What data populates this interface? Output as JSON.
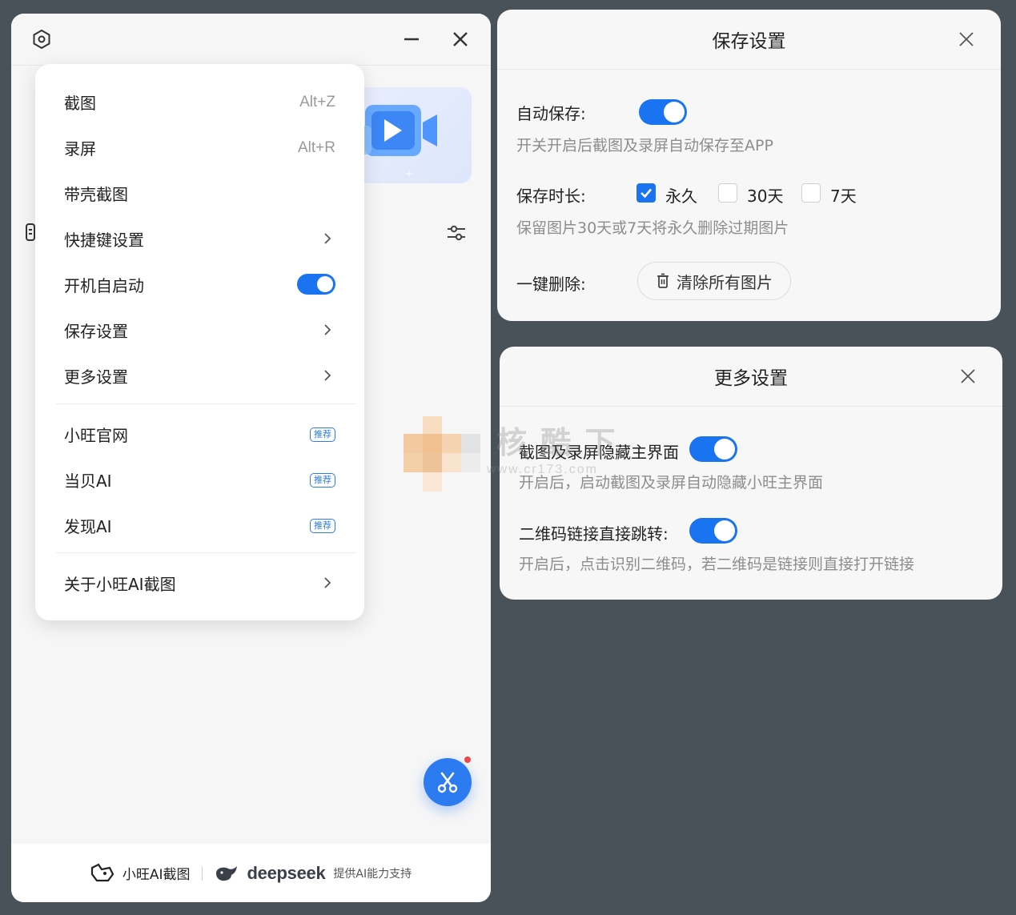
{
  "main_window": {
    "menu": {
      "items": [
        {
          "label": "截图",
          "shortcut": "Alt+Z"
        },
        {
          "label": "录屏",
          "shortcut": "Alt+R"
        },
        {
          "label": "带壳截图"
        },
        {
          "label": "快捷键设置"
        },
        {
          "label": "开机自启动",
          "toggle_on": true
        },
        {
          "label": "保存设置"
        },
        {
          "label": "更多设置"
        },
        {
          "label": "小旺官网",
          "badge": "推荐"
        },
        {
          "label": "当贝AI",
          "badge": "推荐"
        },
        {
          "label": "发现AI",
          "badge": "推荐"
        },
        {
          "label": "关于小旺AI截图"
        }
      ]
    },
    "footer": {
      "app_name": "小旺AI截图",
      "partner": "deepseek",
      "support_text": "提供AI能力支持"
    },
    "fab_icon": "scissors-icon",
    "accent_color": "#2d7bf0"
  },
  "save_settings": {
    "title": "保存设置",
    "auto_save_label": "自动保存:",
    "auto_save_on": true,
    "auto_save_desc": "开关开启后截图及录屏自动保存至APP",
    "duration_label": "保存时长:",
    "duration_options": [
      {
        "label": "永久",
        "checked": true
      },
      {
        "label": "30天",
        "checked": false
      },
      {
        "label": "7天",
        "checked": false
      }
    ],
    "duration_desc": "保留图片30天或7天将永久删除过期图片",
    "delete_label": "一键删除:",
    "clear_button": "清除所有图片"
  },
  "more_settings": {
    "title": "更多设置",
    "hide_label": "截图及录屏隐藏主界面",
    "hide_on": true,
    "hide_desc": "开启后，启动截图及录屏自动隐藏小旺主界面",
    "qr_label": "二维码链接直接跳转:",
    "qr_on": true,
    "qr_desc": "开启后，点击识别二维码，若二维码是链接则直接打开链接"
  },
  "watermark": {
    "text": "核 酷 下",
    "url": "www.cr173.com"
  }
}
